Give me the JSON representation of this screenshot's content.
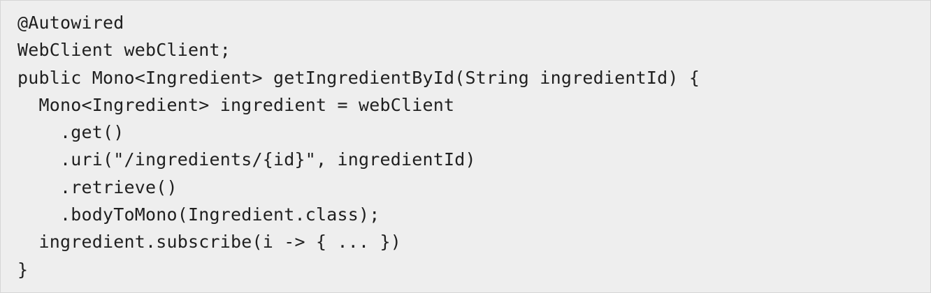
{
  "code": {
    "lines": [
      "@Autowired",
      "WebClient webClient;",
      "public Mono<Ingredient> getIngredientById(String ingredientId) {",
      "  Mono<Ingredient> ingredient = webClient",
      "    .get()",
      "    .uri(\"/ingredients/{id}\", ingredientId)",
      "    .retrieve()",
      "    .bodyToMono(Ingredient.class);",
      "  ingredient.subscribe(i -> { ... })",
      "}"
    ]
  },
  "colors": {
    "background": "#eeeeee",
    "text": "#1f1f1f"
  }
}
